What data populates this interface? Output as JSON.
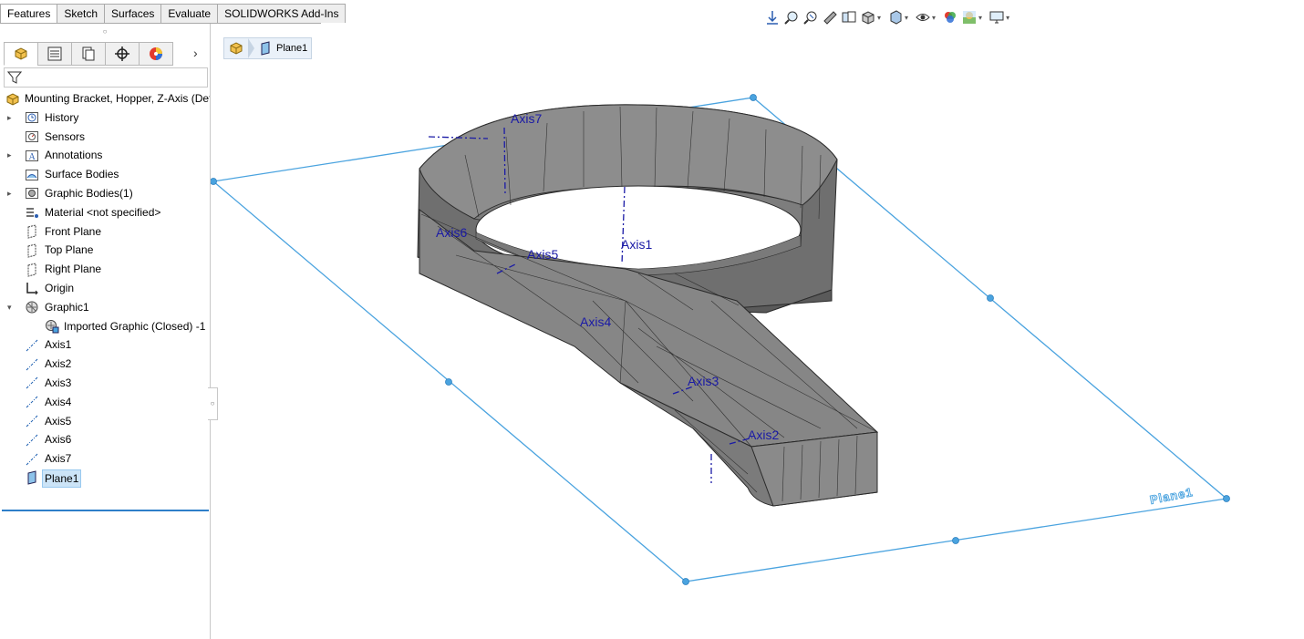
{
  "command_tabs": [
    "Features",
    "Sketch",
    "Surfaces",
    "Evaluate",
    "SOLIDWORKS Add-Ins"
  ],
  "active_tab": "Features",
  "breadcrumb": {
    "item": "Plane1"
  },
  "tree": {
    "root": "Mounting Bracket, Hopper, Z-Axis  (Defa",
    "items": [
      {
        "label": "History",
        "icon": "history-icon"
      },
      {
        "label": "Sensors",
        "icon": "sensors-icon"
      },
      {
        "label": "Annotations",
        "icon": "annotations-icon"
      },
      {
        "label": "Surface Bodies",
        "icon": "surface-bodies-icon"
      },
      {
        "label": "Graphic Bodies(1)",
        "icon": "graphic-bodies-icon"
      },
      {
        "label": "Material <not specified>",
        "icon": "material-icon"
      },
      {
        "label": "Front Plane",
        "icon": "plane-icon"
      },
      {
        "label": "Top Plane",
        "icon": "plane-icon"
      },
      {
        "label": "Right Plane",
        "icon": "plane-icon"
      },
      {
        "label": "Origin",
        "icon": "origin-icon"
      },
      {
        "label": "Graphic1",
        "icon": "graphic-icon"
      },
      {
        "label": "Imported Graphic (Closed) -1",
        "icon": "imported-graphic-icon"
      },
      {
        "label": "Axis1",
        "icon": "axis-icon"
      },
      {
        "label": "Axis2",
        "icon": "axis-icon"
      },
      {
        "label": "Axis3",
        "icon": "axis-icon"
      },
      {
        "label": "Axis4",
        "icon": "axis-icon"
      },
      {
        "label": "Axis5",
        "icon": "axis-icon"
      },
      {
        "label": "Axis6",
        "icon": "axis-icon"
      },
      {
        "label": "Axis7",
        "icon": "axis-icon"
      },
      {
        "label": "Plane1",
        "icon": "plane-icon"
      }
    ]
  },
  "viewport": {
    "axis_labels": [
      "Axis1",
      "Axis2",
      "Axis3",
      "Axis4",
      "Axis5",
      "Axis6",
      "Axis7"
    ],
    "plane_label": "Plane1"
  },
  "colors": {
    "plane": "#4aa3df",
    "axis": "#1a1aa6",
    "model": "#7a7a7a",
    "selection": "#cce4f7"
  }
}
